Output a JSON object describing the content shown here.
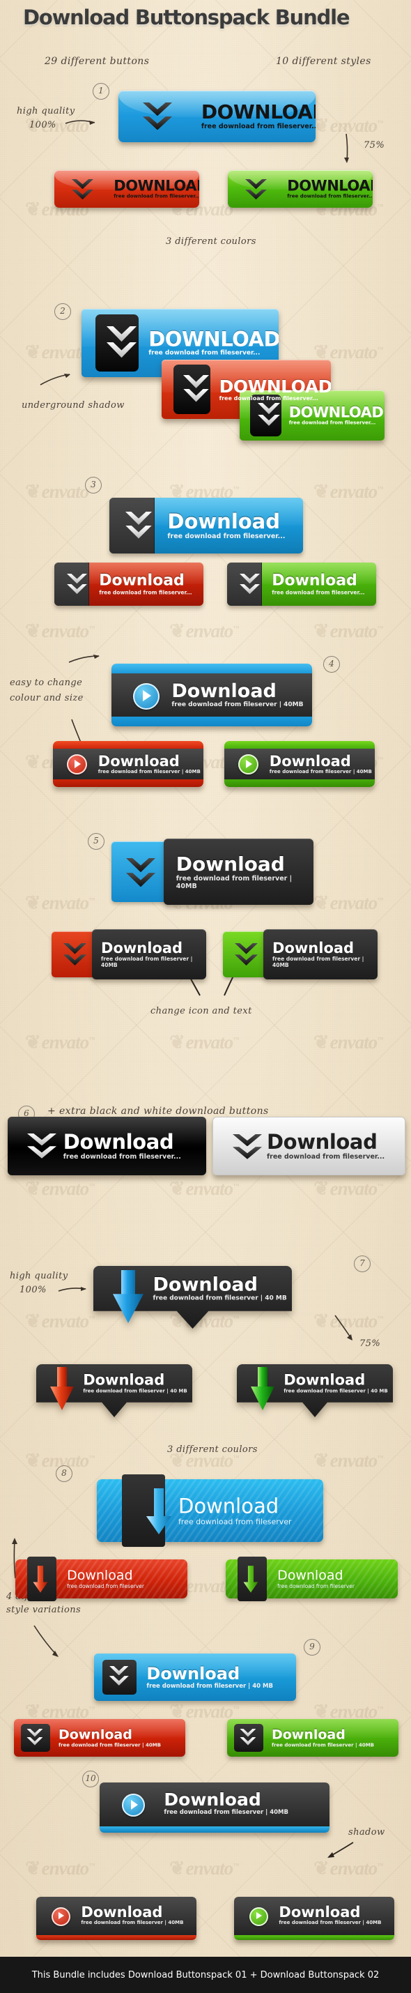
{
  "page": {
    "title": "Download Buttonspack Bundle",
    "bg_color": "#f0e4cd",
    "footer_text": "This Bundle includes Download Buttonspack 01 + Download Buttonspack 02",
    "watermark_text": "envato"
  },
  "annotations": {
    "buttons_count": "29 different buttons",
    "styles_count": "10 different styles",
    "high_quality": "high quality",
    "high_quality_pct": "100%",
    "scale_75": "75%",
    "three_colours_a": "3 different coulors",
    "underground_shadow": "underground shadow",
    "easy_change": "easy to change",
    "easy_change_2": "colour and size",
    "change_icon_text": "change icon and text",
    "extra_bw": "+ extra black and white download buttons",
    "high_quality_b": "high quality",
    "high_quality_b_pct": "100%",
    "scale_75_b": "75%",
    "three_colours_b": "3 different coulors",
    "four_style_var": "4 different",
    "four_style_var_2": "style variations",
    "shadow": "shadow"
  },
  "numbers": [
    "1",
    "2",
    "3",
    "4",
    "5",
    "6",
    "7",
    "8",
    "9",
    "10"
  ],
  "colors": {
    "blue": "#1b9bdc",
    "blue_light": "#4fc3ef",
    "red": "#e0301a",
    "red_dark": "#b91d08",
    "green": "#63c818",
    "green_dark": "#3d9a06",
    "dark": "#2b2b2b",
    "black": "#0d0d0d",
    "white": "#e9e9e9",
    "cyan": "#22a7dd"
  },
  "labels": {
    "download_caps": "DOWNLOAD",
    "download": "Download",
    "sub_basic": "free download from fileserver...",
    "sub_40mb": "free download from fileserver  |  40MB",
    "sub_40mb_sp": "free download from fileserver | 40 MB",
    "sub_plain": "free download from fileserver"
  },
  "sections": [
    {
      "id": 1,
      "style": "glossy-rounded-dark-chevron",
      "buttons": [
        {
          "color": "blue",
          "title": "DOWNLOAD",
          "sub": "free download from fileserver..."
        },
        {
          "color": "red",
          "title": "DOWNLOAD",
          "sub": "free download from fileserver..."
        },
        {
          "color": "green",
          "title": "DOWNLOAD",
          "sub": "free download from fileserver..."
        }
      ]
    },
    {
      "id": 2,
      "style": "black-icon-tab-overlap",
      "buttons": [
        {
          "color": "blue",
          "title": "DOWNLOAD",
          "sub": "free download from fileserver..."
        },
        {
          "color": "red",
          "title": "DOWNLOAD",
          "sub": "free download from fileserver..."
        },
        {
          "color": "green",
          "title": "DOWNLOAD",
          "sub": "free download from fileserver..."
        }
      ]
    },
    {
      "id": 3,
      "style": "dark-left-tab",
      "buttons": [
        {
          "color": "blue",
          "title": "Download",
          "sub": "free download from fileserver..."
        },
        {
          "color": "red",
          "title": "Download",
          "sub": "free download from fileserver..."
        },
        {
          "color": "green",
          "title": "Download",
          "sub": "free download from fileserver..."
        }
      ]
    },
    {
      "id": 4,
      "style": "dark-body-colour-bars-play",
      "buttons": [
        {
          "color": "blue",
          "title": "Download",
          "sub": "free download from fileserver  |  40MB"
        },
        {
          "color": "red",
          "title": "Download",
          "sub": "free download from fileserver  |  40MB"
        },
        {
          "color": "green",
          "title": "Download",
          "sub": "free download from fileserver  |  40MB"
        }
      ]
    },
    {
      "id": 5,
      "style": "colour-square-dark-plate",
      "buttons": [
        {
          "color": "blue",
          "title": "Download",
          "sub": "free download from fileserver  |  40MB"
        },
        {
          "color": "red",
          "title": "Download",
          "sub": "free download from fileserver  |  40MB"
        },
        {
          "color": "green",
          "title": "Download",
          "sub": "free download from fileserver  |  40MB"
        }
      ]
    },
    {
      "id": 6,
      "style": "black-white-wide",
      "buttons": [
        {
          "color": "black",
          "title": "Download",
          "sub": "free download from fileserver..."
        },
        {
          "color": "white",
          "title": "Download",
          "sub": "free download from fileserver..."
        }
      ]
    },
    {
      "id": 7,
      "style": "dark-ribbon-notch-arrow",
      "buttons": [
        {
          "color": "blue",
          "title": "Download",
          "sub": "free download from fileserver | 40 MB"
        },
        {
          "color": "red",
          "title": "Download",
          "sub": "free download from fileserver | 40 MB"
        },
        {
          "color": "green",
          "title": "Download",
          "sub": "free download from fileserver | 40 MB"
        }
      ]
    },
    {
      "id": 8,
      "style": "striped-plate-dark-tab",
      "buttons": [
        {
          "color": "blue",
          "title": "Download",
          "sub": "free download from fileserver"
        },
        {
          "color": "red",
          "title": "Download",
          "sub": "free download from fileserver"
        },
        {
          "color": "green",
          "title": "Download",
          "sub": "free download from fileserver"
        }
      ]
    },
    {
      "id": 9,
      "style": "dark-square-icon-colour-plate",
      "buttons": [
        {
          "color": "blue",
          "title": "Download",
          "sub": "free download from fileserver  |  40 MB"
        },
        {
          "color": "red",
          "title": "Download",
          "sub": "free download from fileserver  |  40MB"
        },
        {
          "color": "green",
          "title": "Download",
          "sub": "free download from fileserver  |  40MB"
        }
      ]
    },
    {
      "id": 10,
      "style": "dark-plate-colour-edge-play",
      "buttons": [
        {
          "color": "blue",
          "title": "Download",
          "sub": "free download from fileserver  |  40MB"
        },
        {
          "color": "red",
          "title": "Download",
          "sub": "free download from fileserver  |  40MB"
        },
        {
          "color": "green",
          "title": "Download",
          "sub": "free download from fileserver  |  40MB"
        }
      ]
    }
  ]
}
